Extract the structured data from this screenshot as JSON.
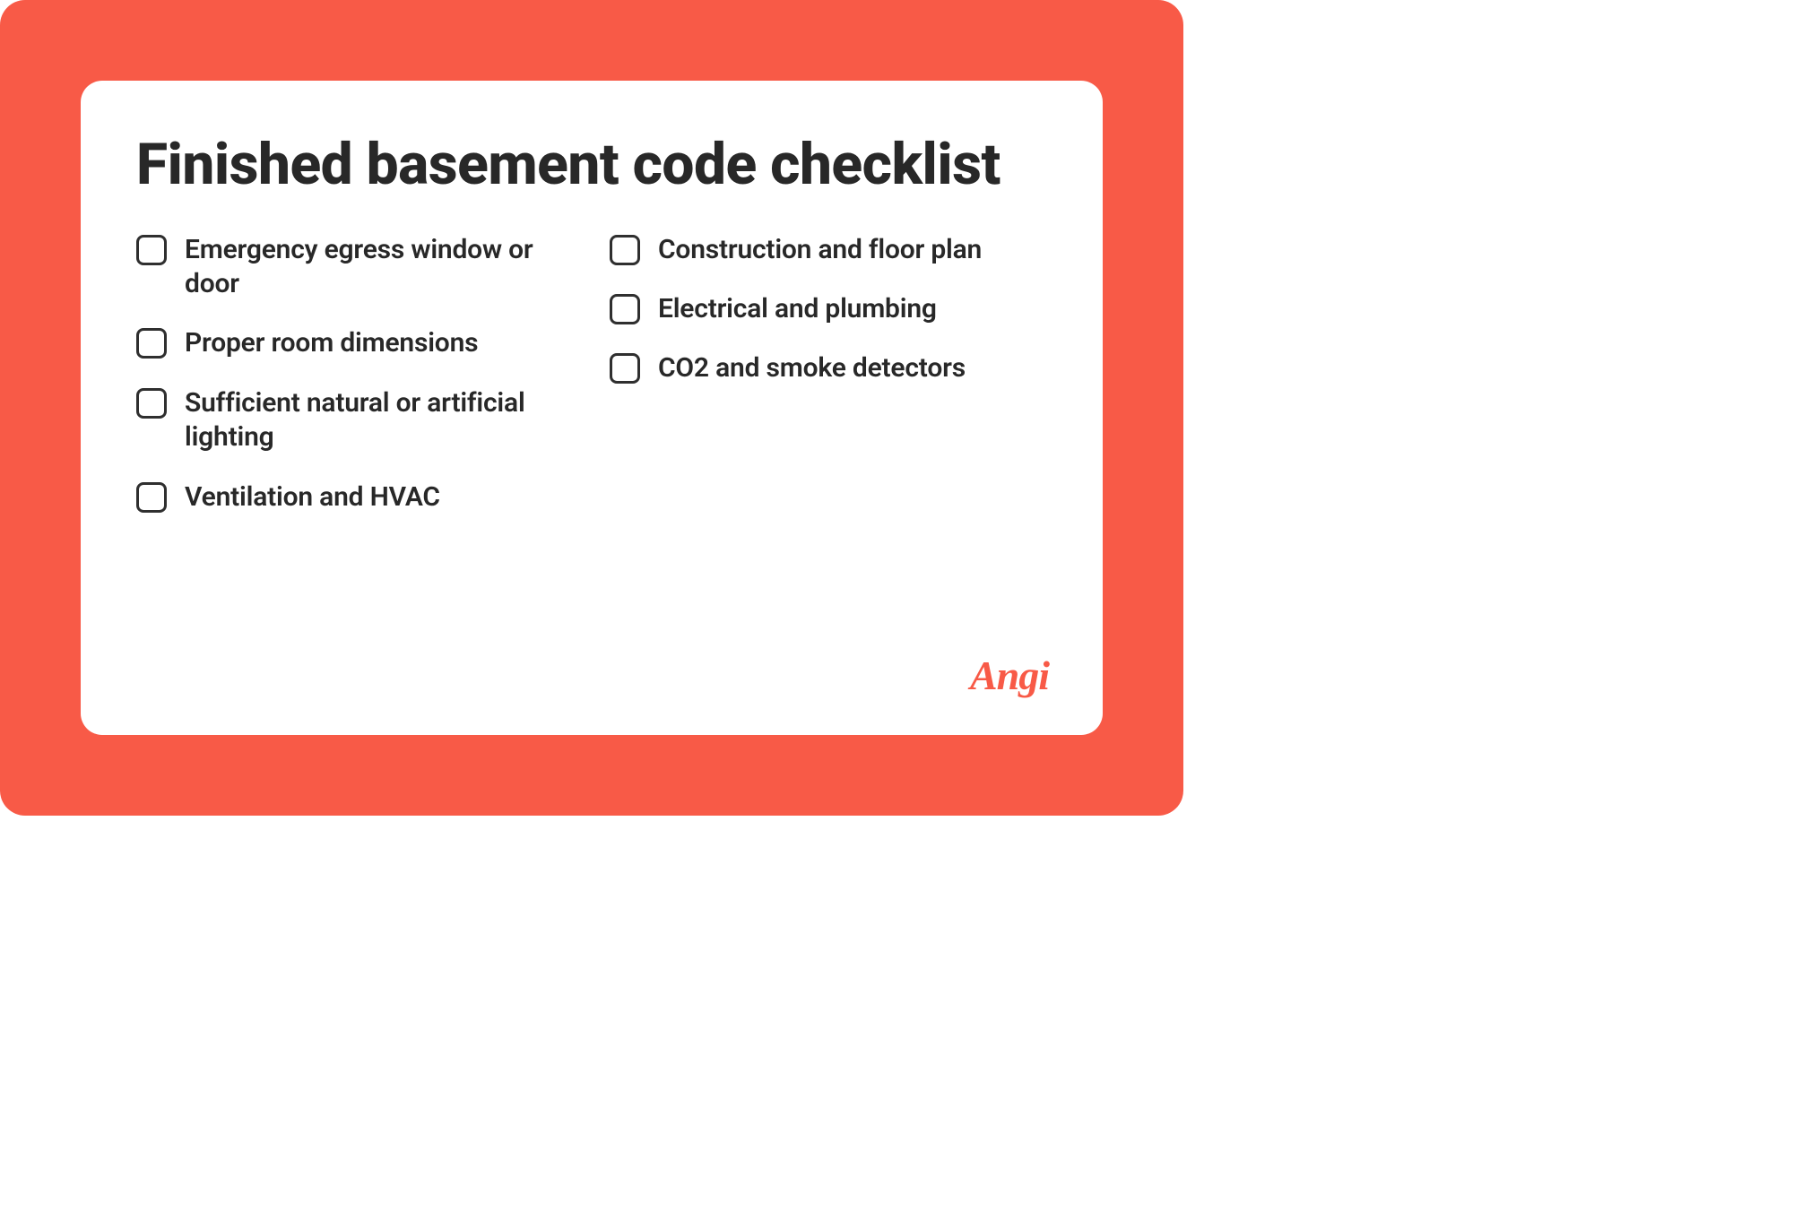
{
  "title": "Finished basement code checklist",
  "checklist": {
    "left": [
      "Emergency egress window or door",
      "Proper room dimensions",
      "Sufficient natural or artificial lighting",
      "Ventilation and HVAC"
    ],
    "right": [
      "Construction and floor plan",
      "Electrical and plumbing",
      "CO2 and smoke detectors"
    ]
  },
  "brand": "Angi",
  "colors": {
    "accent": "#f85a47",
    "text": "#282828"
  }
}
